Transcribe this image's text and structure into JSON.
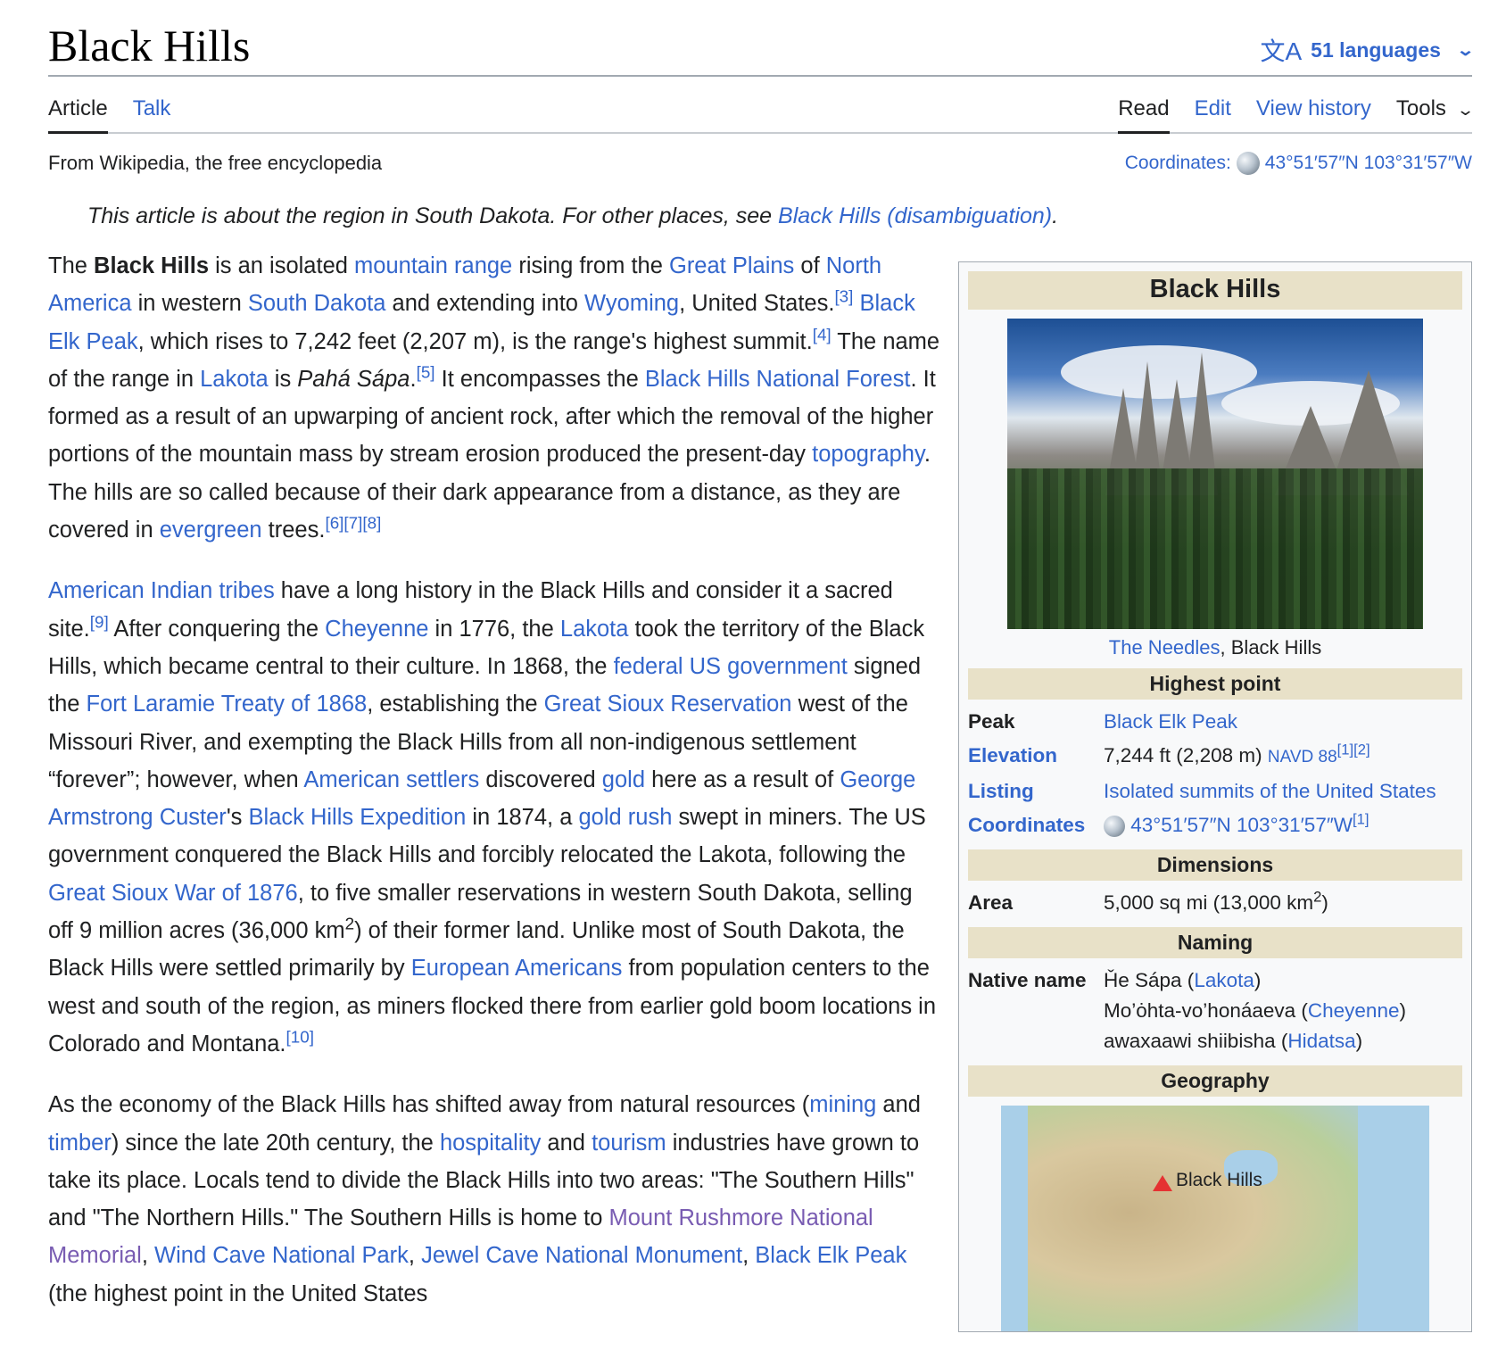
{
  "header": {
    "title": "Black Hills",
    "languages_label": "51 languages",
    "lang_icon": "文A"
  },
  "tabs": {
    "article": "Article",
    "talk": "Talk",
    "read": "Read",
    "edit": "Edit",
    "view_history": "View history",
    "tools": "Tools"
  },
  "subheader": {
    "tagline": "From Wikipedia, the free encyclopedia",
    "coords_label": "Coordinates:",
    "coords_value": "43°51′57″N 103°31′57″W"
  },
  "hatnote": {
    "text": "This article is about the region in South Dakota. For other places, see",
    "link": "Black Hills (disambiguation)",
    "end": "."
  },
  "p1": {
    "t1": "The ",
    "bold": "Black Hills",
    "t2": " is an isolated ",
    "l1": "mountain range",
    "t3": " rising from the ",
    "l2": "Great Plains",
    "t4": " of ",
    "l3": "North America",
    "t5": " in western ",
    "l4": "South Dakota",
    "t6": " and extending into ",
    "l5": "Wyoming",
    "t7": ", United States.",
    "r1": "[3]",
    "t8": " ",
    "l6": "Black Elk Peak",
    "t9": ", which rises to 7,242 feet (2,207 m), is the range's highest summit.",
    "r2": "[4]",
    "t10": " The name of the range in ",
    "l7": "Lakota",
    "t11": " is ",
    "ital": "Pahá Sápa",
    "t12": ".",
    "r3": "[5]",
    "t13": " It encompasses the ",
    "l8": "Black Hills National Forest",
    "t14": ". It formed as a result of an upwarping of ancient rock, after which the removal of the higher portions of the mountain mass by stream erosion produced the present-day ",
    "l9": "topography",
    "t15": ". The hills are so called because of their dark appearance from a distance, as they are covered in ",
    "l10": "evergreen",
    "t16": " trees.",
    "r4": "[6][7][8]"
  },
  "p2": {
    "l1": "American Indian tribes",
    "t1": " have a long history in the Black Hills and consider it a sacred site.",
    "r1": "[9]",
    "t2": " After conquering the ",
    "l2": "Cheyenne",
    "t3": " in 1776, the ",
    "l3": "Lakota",
    "t4": " took the territory of the Black Hills, which became central to their culture. In 1868, the ",
    "l4": "federal US government",
    "t5": " signed the ",
    "l5": "Fort Laramie Treaty of 1868",
    "t6": ", establishing the ",
    "l6": "Great Sioux Reservation",
    "t7": " west of the Missouri River, and exempting the Black Hills from all non-indigenous settlement “forever”; however, when ",
    "l7": "American settlers",
    "t8": " discovered ",
    "l8": "gold",
    "t9": " here as a result of ",
    "l9": "George Armstrong Custer",
    "t10": "'s ",
    "l10": "Black Hills Expedition",
    "t11": " in 1874, a ",
    "l11": "gold rush",
    "t12": " swept in miners. The US government conquered the Black Hills and forcibly relocated the Lakota, following the ",
    "l12": "Great Sioux War of 1876",
    "t13": ", to five smaller reservations in western South Dakota, selling off 9 million acres (36,000 km",
    "sup": "2",
    "t14": ") of their former land. Unlike most of South Dakota, the Black Hills were settled primarily by ",
    "l13": "European Americans",
    "t15": " from population centers to the west and south of the region, as miners flocked there from earlier gold boom locations in Colorado and Montana.",
    "r2": "[10]"
  },
  "p3": {
    "t1": "As the economy of the Black Hills has shifted away from natural resources (",
    "l1": "mining",
    "t2": " and ",
    "l2": "timber",
    "t3": ") since the late 20th century, the ",
    "l3": "hospitality",
    "t4": " and ",
    "l4": "tourism",
    "t5": " industries have grown to take its place. Locals tend to divide the Black Hills into two areas: \"The Southern Hills\" and \"The Northern Hills.\" The Southern Hills is home to ",
    "l5": "Mount Rushmore National Memorial",
    "t6": ", ",
    "l6": "Wind Cave National Park",
    "t7": ", ",
    "l7": "Jewel Cave National Monument",
    "t8": ", ",
    "l8": "Black Elk Peak",
    "t9": " (the highest point in the United States"
  },
  "infobox": {
    "title": "Black Hills",
    "caption_link": "The Needles",
    "caption_text": ", Black Hills",
    "section_highest": "Highest point",
    "peak_label": "Peak",
    "peak_value": "Black Elk Peak",
    "elev_label": "Elevation",
    "elev_value": "7,244 ft (2,208 m) ",
    "elev_navd": "NAVD 88",
    "elev_refs": "[1][2]",
    "listing_label": "Listing",
    "listing_value": "Isolated summits of the United States",
    "coords_label": "Coordinates",
    "coords_value": "43°51′57″N 103°31′57″W",
    "coords_ref": "[1]",
    "section_dimensions": "Dimensions",
    "area_label": "Area",
    "area_value": "5,000 sq mi (13,000 km",
    "area_sup": "2",
    "area_end": ")",
    "section_naming": "Naming",
    "native_label": "Native name",
    "native_1": "Ȟe Sápa (",
    "native_1_link": "Lakota",
    "native_2": "Mo’ȯhta-vo’honáaeva (",
    "native_2_link": "Cheyenne",
    "native_3": "awaxaawi shiibisha (",
    "native_3_link": "Hidatsa",
    "close_paren": ")",
    "section_geography": "Geography",
    "map_label": "Black Hills"
  },
  "colors": {
    "link": "#3366cc",
    "visited": "#795cb2",
    "infobox_header": "#e8e1c8",
    "marker": "#e53232"
  }
}
